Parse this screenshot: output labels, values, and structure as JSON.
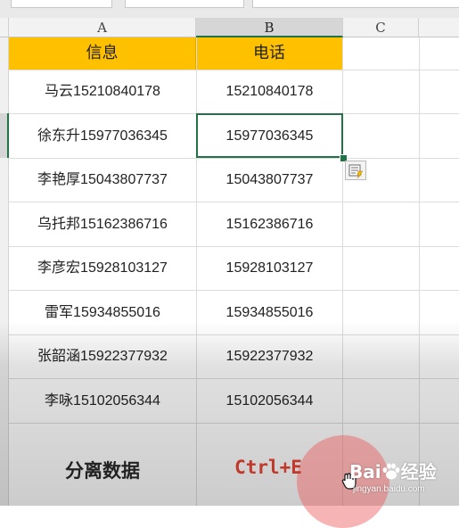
{
  "columns": [
    "A",
    "B",
    "C"
  ],
  "table": {
    "headers": [
      "信息",
      "电话"
    ],
    "rows": [
      [
        "马云15210840178",
        "15210840178"
      ],
      [
        "徐东升15977036345",
        "15977036345"
      ],
      [
        "李艳厚15043807737",
        "15043807737"
      ],
      [
        "乌托邦15162386716",
        "15162386716"
      ],
      [
        "李彦宏15928103127",
        "15928103127"
      ],
      [
        "雷军15934855016",
        "15934855016"
      ],
      [
        "张韶涵15922377932",
        "15922377932"
      ],
      [
        "李咏15102056344",
        "15102056344"
      ]
    ]
  },
  "caption": {
    "left": "分离数据",
    "right": "Ctrl+E"
  },
  "watermark": {
    "brand_prefix": "Bai",
    "brand_suffix": "经验",
    "site": "jingyan.baidu.com"
  },
  "colors": {
    "header_fill": "#ffc000",
    "selection": "#217346",
    "caption_accent": "#c0392b"
  },
  "icons": [
    "flash-fill-options-icon",
    "move-cursor-icon",
    "baidu-paw-icon"
  ]
}
